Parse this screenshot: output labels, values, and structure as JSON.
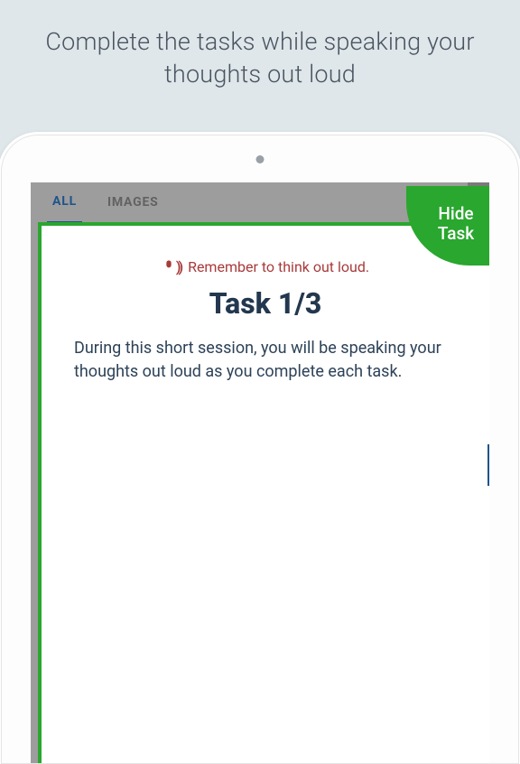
{
  "headline": "Complete the tasks while speaking your thoughts out loud",
  "tabbar": {
    "all": "ALL",
    "images": "IMAGES"
  },
  "hide_task": {
    "line1": "Hide",
    "line2": "Task"
  },
  "overlay": {
    "reminder": "Remember to think out loud.",
    "task_title": "Task 1/3",
    "task_desc": "During this short session, you will be speaking your thoughts out loud as you complete each task."
  }
}
